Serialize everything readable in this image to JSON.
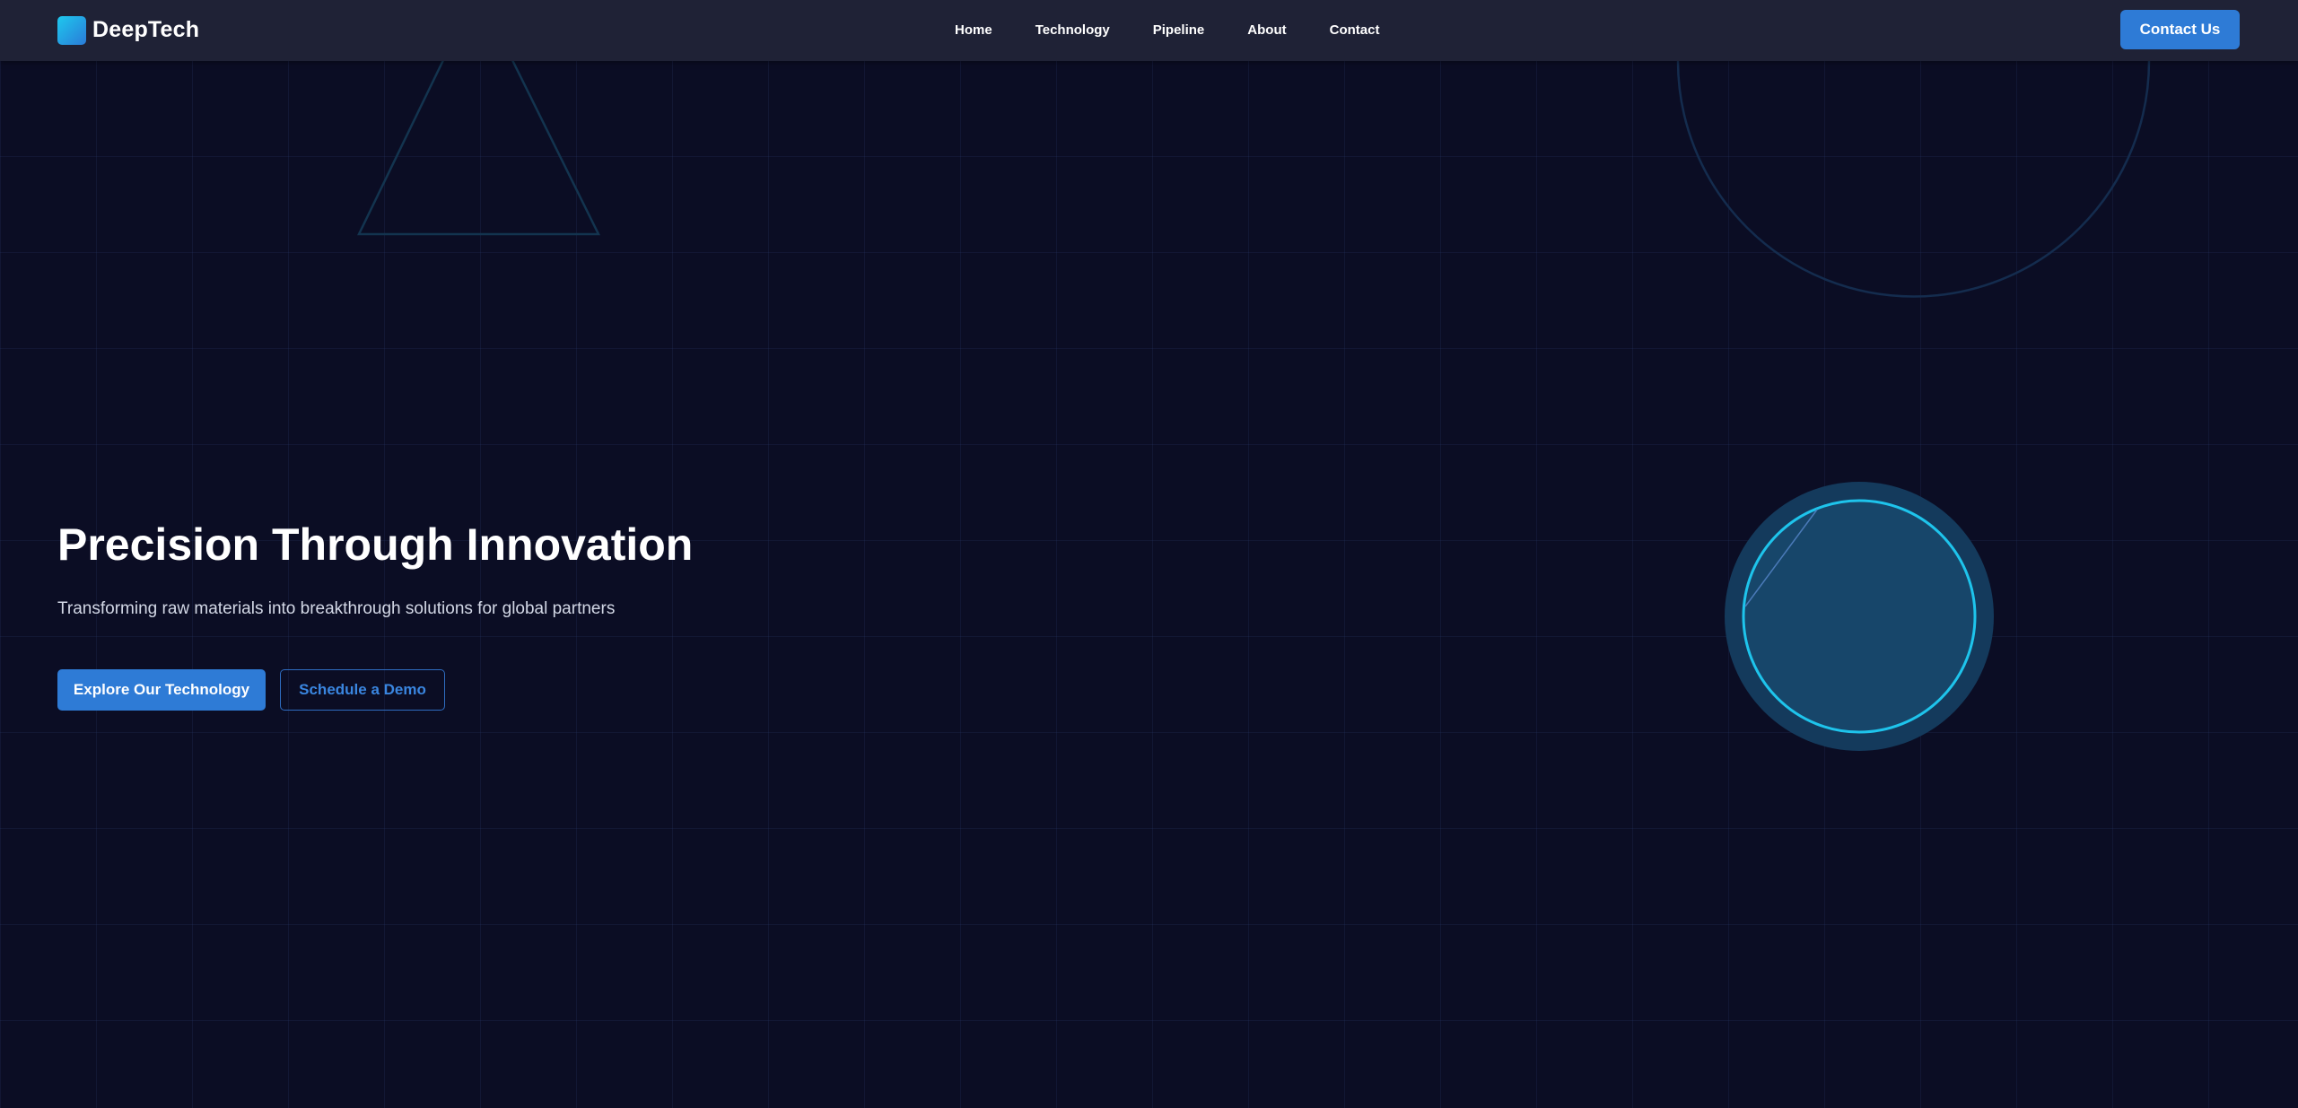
{
  "brand": {
    "name": "DeepTech",
    "logo_colors": [
      "#1ec8ee",
      "#2a7bd8"
    ]
  },
  "nav": {
    "items": [
      {
        "label": "Home"
      },
      {
        "label": "Technology"
      },
      {
        "label": "Pipeline"
      },
      {
        "label": "About"
      },
      {
        "label": "Contact"
      }
    ]
  },
  "header": {
    "cta_label": "Contact Us"
  },
  "hero": {
    "title": "Precision Through Innovation",
    "subtitle": "Transforming raw materials into breakthrough solutions for global partners",
    "primary_button": "Explore Our Technology",
    "secondary_button": "Schedule a Demo"
  },
  "colors": {
    "background": "#0b0d24",
    "header_background": "#1f2236",
    "accent": "#2e7bd6",
    "orb_ring": "#1ec4ec"
  },
  "decor": {
    "shapes": [
      "triangle-outline",
      "circle-outline",
      "glowing-orb"
    ]
  }
}
